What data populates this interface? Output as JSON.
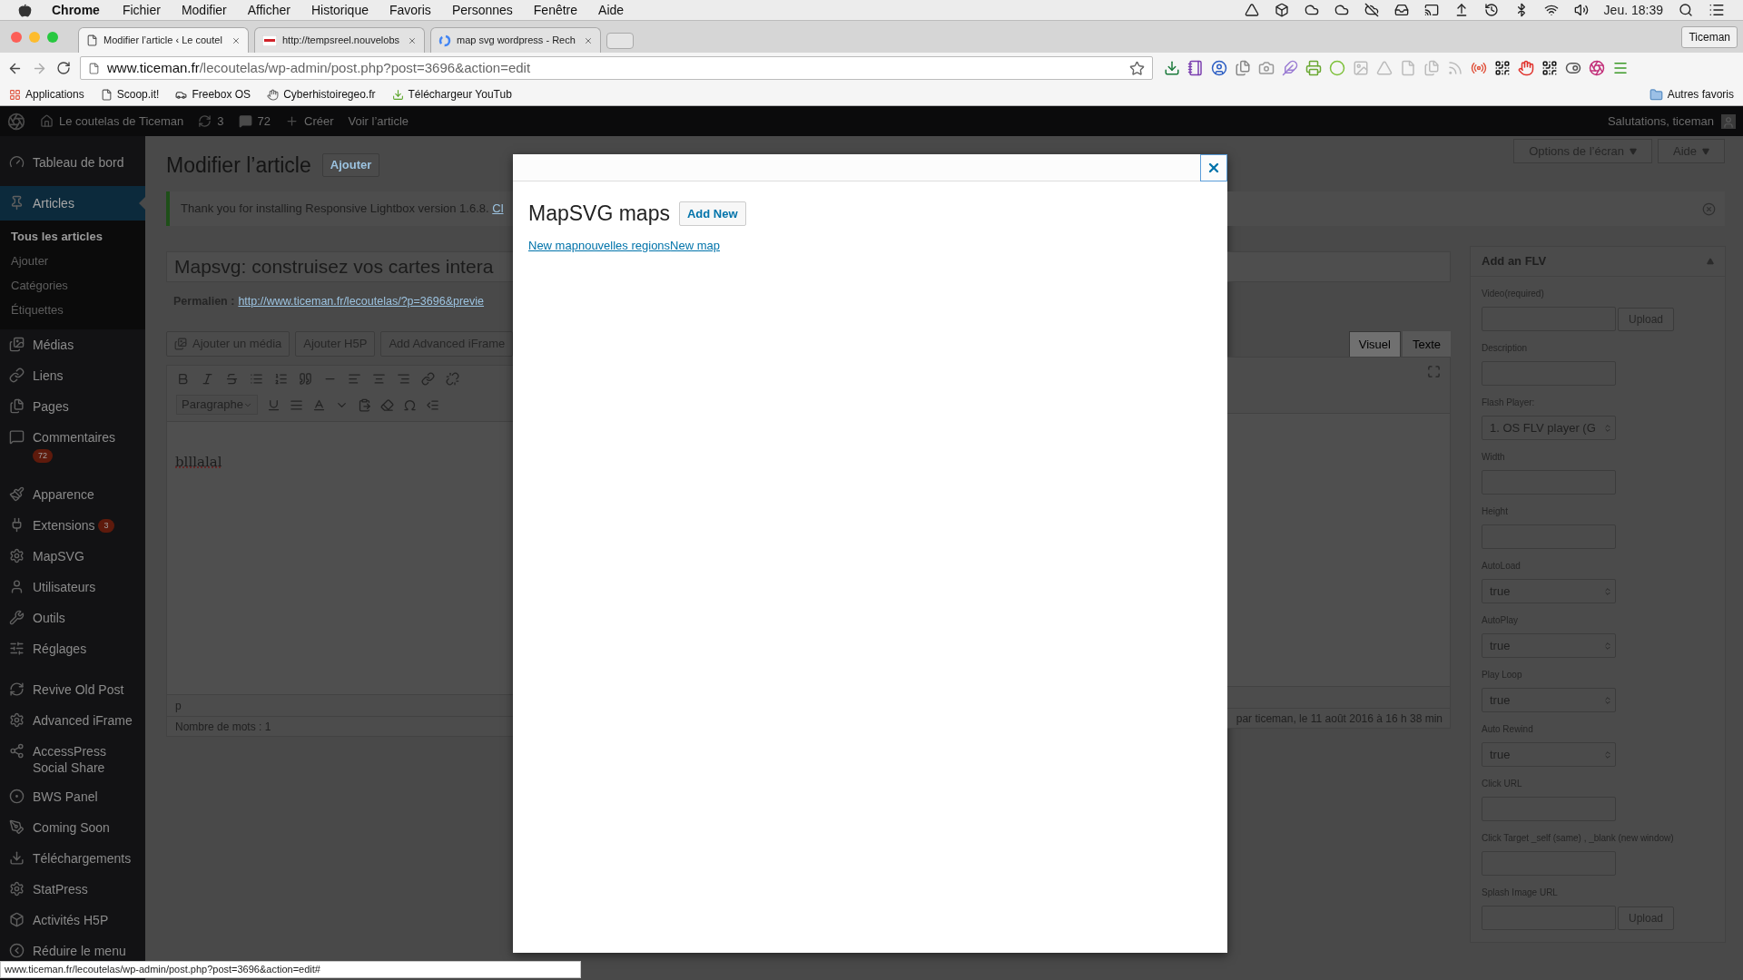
{
  "menubar": {
    "app": "Chrome",
    "items": [
      "Fichier",
      "Modifier",
      "Afficher",
      "Historique",
      "Favoris",
      "Personnes",
      "Fenêtre",
      "Aide"
    ],
    "clock": "Jeu. 18:39"
  },
  "browser": {
    "tabs": [
      {
        "title": "Modifier l’article ‹ Le coutel",
        "selected": true,
        "kind": "page"
      },
      {
        "title": "http://tempsreel.nouvelobs",
        "selected": false,
        "kind": "news"
      },
      {
        "title": "map svg wordpress - Rech",
        "selected": false,
        "kind": "search"
      }
    ],
    "profile": "Ticeman",
    "url_host": "www.ticeman.fr",
    "url_path": "/lecoutelas/wp-admin/post.php?post=3696&action=edit",
    "bookmarks": [
      {
        "label": "Applications",
        "kind": "apps"
      },
      {
        "label": "Scoop.it!",
        "kind": "page"
      },
      {
        "label": "Freebox OS",
        "kind": "box"
      },
      {
        "label": "Cyberhistoiregeo.fr",
        "kind": "fox"
      },
      {
        "label": "Téléchargeur YouTub",
        "kind": "download"
      }
    ],
    "other_bookmarks": "Autres favoris"
  },
  "admin_bar": {
    "site": "Le coutelas de Ticeman",
    "updates": "3",
    "comments": "72",
    "new": "Créer",
    "view": "Voir l’article",
    "greeting": "Salutations, ticeman"
  },
  "sidebar": {
    "groups": [
      [
        {
          "label": "Tableau de bord",
          "selected": false
        }
      ],
      [
        {
          "label": "Articles",
          "selected": true,
          "children": [
            {
              "label": "Tous les articles",
              "selected": true
            },
            {
              "label": "Ajouter",
              "selected": false
            },
            {
              "label": "Catégories",
              "selected": false
            },
            {
              "label": "Étiquettes",
              "selected": false
            }
          ]
        },
        {
          "label": "Médias",
          "selected": false
        },
        {
          "label": "Liens",
          "selected": false
        },
        {
          "label": "Pages",
          "selected": false
        },
        {
          "label": "Commentaires",
          "selected": false,
          "badge": "72",
          "badge_below": true
        }
      ],
      [
        {
          "label": "Apparence",
          "selected": false
        },
        {
          "label": "Extensions",
          "selected": false,
          "badge": "3",
          "badge_below": false
        },
        {
          "label": "MapSVG",
          "selected": false
        },
        {
          "label": "Utilisateurs",
          "selected": false
        },
        {
          "label": "Outils",
          "selected": false
        },
        {
          "label": "Réglages",
          "selected": false
        }
      ],
      [
        {
          "label": "Revive Old Post",
          "selected": false
        },
        {
          "label": "Advanced iFrame",
          "selected": false
        },
        {
          "label": "AccessPress Social Share",
          "selected": false
        },
        {
          "label": "BWS Panel",
          "selected": false
        },
        {
          "label": "Coming Soon",
          "selected": false
        },
        {
          "label": "Téléchargements",
          "selected": false
        },
        {
          "label": "StatPress",
          "selected": false
        },
        {
          "label": "Activités H5P",
          "selected": false
        },
        {
          "label": "Réduire le menu",
          "selected": false
        }
      ]
    ]
  },
  "screen_meta": [
    "Options de l’écran",
    "Aide"
  ],
  "page": {
    "heading": "Modifier l’article",
    "add_button": "Ajouter",
    "notice": {
      "text": "Thank you for installing Responsive Lightbox version 1.6.8.",
      "link": "Cl"
    },
    "post_title": "Mapsvg: construisez vos cartes intera",
    "permalink_label": "Permalien :",
    "permalink_url": "http://www.ticeman.fr/lecoutelas/?p=3696&previe",
    "media_buttons": [
      "Ajouter un média",
      "Ajouter H5P",
      "Add Advanced iFrame"
    ],
    "editor_tabs": [
      {
        "label": "Visuel",
        "selected": true
      },
      {
        "label": "Texte",
        "selected": false
      }
    ],
    "format": "Paragraphe",
    "content": "blllalal",
    "path": "p",
    "word_count": "Nombre de mots : 1",
    "last_edit": "par ticeman, le 11 août 2016 à 16 h 38 min"
  },
  "metabox": {
    "title": "Add an FLV",
    "expanded": true,
    "fields": [
      {
        "kind": "upload",
        "label": "Video(required)",
        "button": "Upload"
      },
      {
        "kind": "text",
        "label": "Description"
      },
      {
        "kind": "select",
        "label": "Flash Player:",
        "value": "1. OS FLV player (G"
      },
      {
        "kind": "text",
        "label": "Width"
      },
      {
        "kind": "text",
        "label": "Height"
      },
      {
        "kind": "select",
        "label": "AutoLoad",
        "value": "true"
      },
      {
        "kind": "select",
        "label": "AutoPlay",
        "value": "true"
      },
      {
        "kind": "select",
        "label": "Play Loop",
        "value": "true"
      },
      {
        "kind": "select",
        "label": "Auto Rewind",
        "value": "true"
      },
      {
        "kind": "text",
        "label": "Click URL"
      },
      {
        "kind": "text",
        "label": "Click Target _self (same) , _blank (new window)"
      },
      {
        "kind": "upload",
        "label": "Splash Image URL",
        "button": "Upload"
      }
    ]
  },
  "modal": {
    "heading": "MapSVG maps",
    "add_new": "Add New",
    "links": [
      "New map",
      "nouvelles regions",
      "New map"
    ]
  },
  "status_url": "www.ticeman.fr/lecoutelas/wp-admin/post.php?post=3696&action=edit#"
}
